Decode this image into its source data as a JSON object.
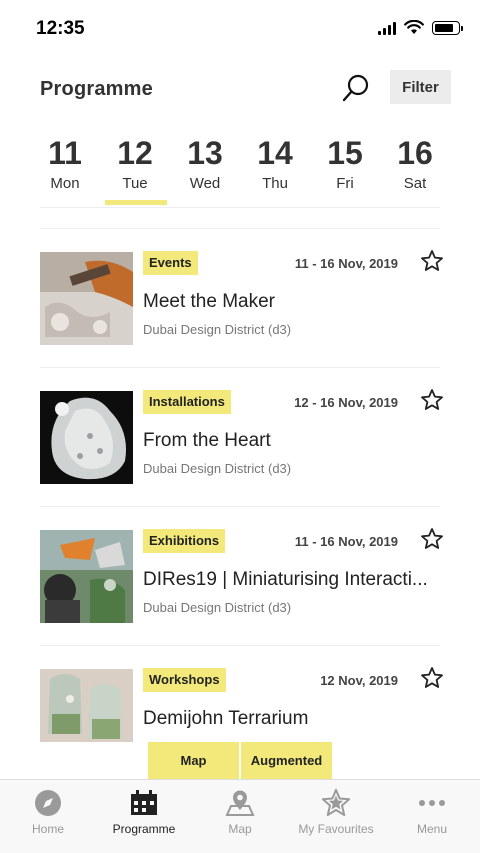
{
  "status_bar": {
    "time": "12:35"
  },
  "header": {
    "title": "Programme",
    "filter_label": "Filter"
  },
  "dates": [
    {
      "num": "11",
      "day": "Mon",
      "active": false
    },
    {
      "num": "12",
      "day": "Tue",
      "active": true
    },
    {
      "num": "13",
      "day": "Wed",
      "active": false
    },
    {
      "num": "14",
      "day": "Thu",
      "active": false
    },
    {
      "num": "15",
      "day": "Fri",
      "active": false
    },
    {
      "num": "16",
      "day": "Sat",
      "active": false
    }
  ],
  "events": [
    {
      "tag": "Events",
      "date": "11 - 16 Nov, 2019",
      "title": "Meet the Maker",
      "venue": "Dubai Design District (d3)",
      "icon": "star-outline-icon"
    },
    {
      "tag": "Installations",
      "date": "12 - 16 Nov, 2019",
      "title": "From the Heart",
      "venue": "Dubai Design District (d3)",
      "icon": "star-outline-icon"
    },
    {
      "tag": "Exhibitions",
      "date": "11 - 16 Nov, 2019",
      "title": "DIRes19 |  Miniaturising Interacti...",
      "venue": "Dubai Design District (d3)",
      "icon": "star-outline-icon"
    },
    {
      "tag": "Workshops",
      "date": "12 Nov, 2019",
      "title": "Demijohn Terrarium",
      "venue": "",
      "icon": "star-outline-icon"
    }
  ],
  "pills": {
    "map": "Map",
    "augmented": "Augmented"
  },
  "tabs": [
    {
      "label": "Home",
      "icon": "compass-icon",
      "active": false
    },
    {
      "label": "Programme",
      "icon": "calendar-icon",
      "active": true
    },
    {
      "label": "Map",
      "icon": "map-pin-icon",
      "active": false
    },
    {
      "label": "My Favourites",
      "icon": "star-icon",
      "active": false
    },
    {
      "label": "Menu",
      "icon": "more-dots-icon",
      "active": false
    }
  ],
  "colors": {
    "accent": "#f2e97a",
    "text": "#222222",
    "muted": "#999999"
  }
}
